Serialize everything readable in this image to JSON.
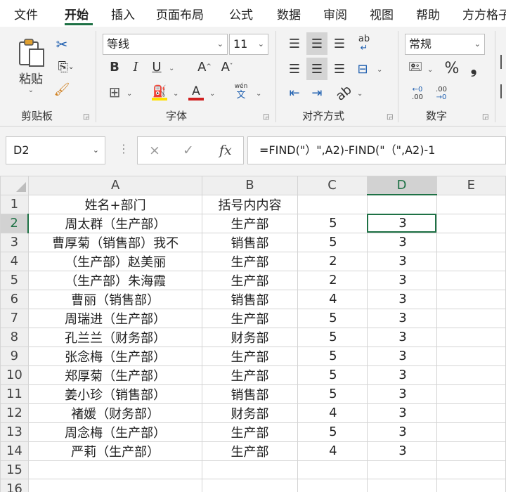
{
  "menu": {
    "tabs": [
      "文件",
      "开始",
      "插入",
      "页面布局",
      "公式",
      "数据",
      "审阅",
      "视图",
      "帮助",
      "方方格子"
    ],
    "active": "开始"
  },
  "ribbon": {
    "clipboard": {
      "paste_label": "粘贴",
      "group_label": "剪贴板"
    },
    "font": {
      "font_name": "等线",
      "font_size": "11",
      "group_label": "字体",
      "bold": "B",
      "italic": "I",
      "underline": "U",
      "grow": "A",
      "shrink": "A",
      "font_color_glyph": "A",
      "phonetic_top": "wén",
      "phonetic_bottom": "文",
      "font_color": "#d02020",
      "fill_color": "#ffe000"
    },
    "alignment": {
      "group_label": "对齐方式",
      "wrap_glyph": "ab"
    },
    "number": {
      "format": "常规",
      "group_label": "数字",
      "percent": "%",
      "comma": "❟",
      "inc_top": "←0",
      "inc_bottom": ".00",
      "dec_top": ".00",
      "dec_bottom": "→0"
    }
  },
  "formula_bar": {
    "name_box": "D2",
    "cancel": "×",
    "enter": "✓",
    "fx": "fx",
    "formula": "=FIND(\"）\",A2)-FIND(\"（\",A2)-1"
  },
  "sheet": {
    "columns": [
      "A",
      "B",
      "C",
      "D",
      "E"
    ],
    "selected_column": "D",
    "selected_row": 2,
    "rows": [
      {
        "n": 1,
        "a": "姓名+部门",
        "b": "括号内内容",
        "c": "",
        "d": ""
      },
      {
        "n": 2,
        "a": "周太群（生产部）",
        "b": "生产部",
        "c": "5",
        "d": "3"
      },
      {
        "n": 3,
        "a": "曹厚菊（销售部）我不",
        "b": "销售部",
        "c": "5",
        "d": "3"
      },
      {
        "n": 4,
        "a": "（生产部）赵美丽",
        "b": "生产部",
        "c": "2",
        "d": "3"
      },
      {
        "n": 5,
        "a": "（生产部）朱海霞",
        "b": "生产部",
        "c": "2",
        "d": "3"
      },
      {
        "n": 6,
        "a": "曹丽（销售部）",
        "b": "销售部",
        "c": "4",
        "d": "3"
      },
      {
        "n": 7,
        "a": "周瑞进（生产部）",
        "b": "生产部",
        "c": "5",
        "d": "3"
      },
      {
        "n": 8,
        "a": "孔兰兰（财务部）",
        "b": "财务部",
        "c": "5",
        "d": "3"
      },
      {
        "n": 9,
        "a": "张念梅（生产部）",
        "b": "生产部",
        "c": "5",
        "d": "3"
      },
      {
        "n": 10,
        "a": "郑厚菊（生产部）",
        "b": "生产部",
        "c": "5",
        "d": "3"
      },
      {
        "n": 11,
        "a": "姜小珍（销售部）",
        "b": "销售部",
        "c": "5",
        "d": "3"
      },
      {
        "n": 12,
        "a": "褚媛（财务部）",
        "b": "财务部",
        "c": "4",
        "d": "3"
      },
      {
        "n": 13,
        "a": "周念梅（生产部）",
        "b": "生产部",
        "c": "5",
        "d": "3"
      },
      {
        "n": 14,
        "a": "严莉（生产部）",
        "b": "生产部",
        "c": "4",
        "d": "3"
      },
      {
        "n": 15,
        "a": "",
        "b": "",
        "c": "",
        "d": ""
      },
      {
        "n": 16,
        "a": "",
        "b": "",
        "c": "",
        "d": ""
      }
    ]
  },
  "colors": {
    "accent": "#1e7145",
    "ribbon_bg": "#f3f3f3",
    "grid_line": "#d4d4d4"
  }
}
